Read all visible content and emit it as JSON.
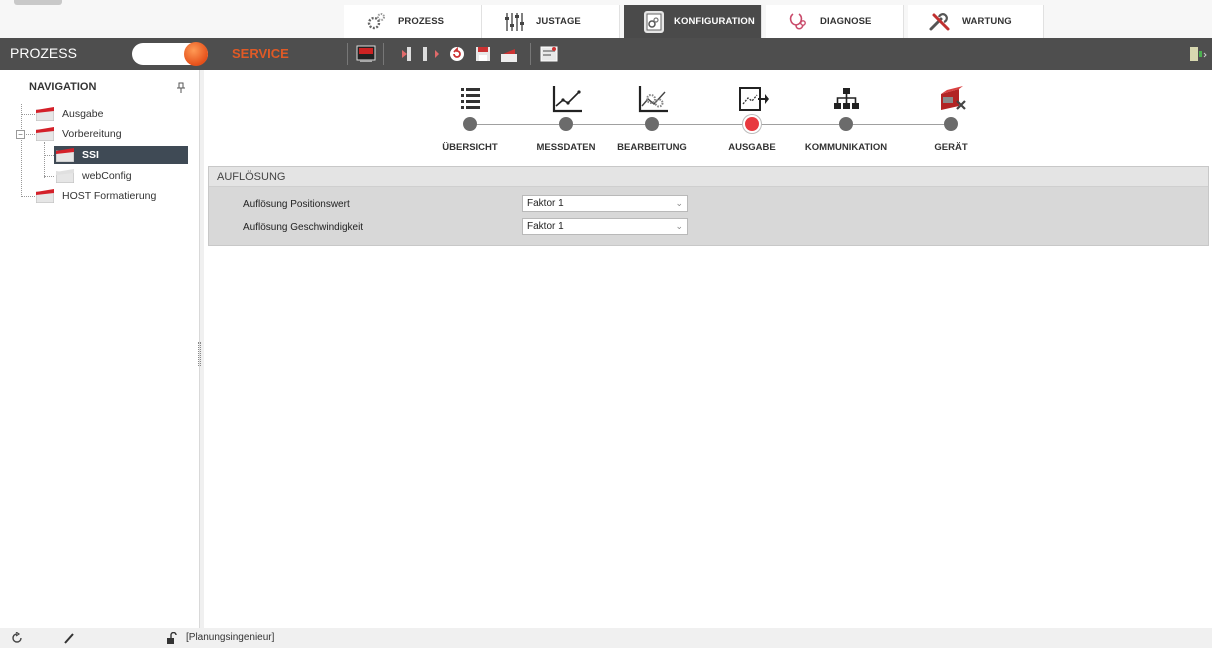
{
  "top_tabs": [
    {
      "label": "PROZESS",
      "icon": "gears-icon"
    },
    {
      "label": "JUSTAGE",
      "icon": "sliders-icon"
    },
    {
      "label": "KONFIGURATION",
      "icon": "config-icon",
      "active": true
    },
    {
      "label": "DIAGNOSE",
      "icon": "stethoscope-icon"
    },
    {
      "label": "WARTUNG",
      "icon": "tools-icon"
    }
  ],
  "toolbar": {
    "mode_label": "PROZESS",
    "service_label": "SERVICE",
    "buttons": [
      "display-icon",
      "download-device-icon",
      "upload-device-icon",
      "reset-icon",
      "save-icon",
      "erase-icon",
      "report-icon"
    ],
    "right_button": "device-status-icon"
  },
  "navigation": {
    "title": "NAVIGATION",
    "items": [
      {
        "label": "Ausgabe",
        "level": 1
      },
      {
        "label": "Vorbereitung",
        "level": 1,
        "expandable": true
      },
      {
        "label": "SSI",
        "level": 2,
        "selected": true
      },
      {
        "label": "webConfig",
        "level": 2
      },
      {
        "label": "HOST Formatierung",
        "level": 1
      }
    ]
  },
  "steps": [
    {
      "label": "ÜBERSICHT",
      "icon": "list-icon"
    },
    {
      "label": "MESSDATEN",
      "icon": "line-chart-icon"
    },
    {
      "label": "BEARBEITUNG",
      "icon": "chart-gears-icon"
    },
    {
      "label": "AUSGABE",
      "icon": "output-icon",
      "active": true
    },
    {
      "label": "KOMMUNIKATION",
      "icon": "network-icon"
    },
    {
      "label": "GERÄT",
      "icon": "device-icon"
    }
  ],
  "section": {
    "title": "AUFLÖSUNG",
    "rows": [
      {
        "label": "Auflösung Positionswert",
        "value": "Faktor 1"
      },
      {
        "label": "Auflösung Geschwindigkeit",
        "value": "Faktor 1"
      }
    ]
  },
  "status_bar": {
    "user_role": "[Planungsingenieur]"
  },
  "colors": {
    "accent_red": "#e8393f",
    "toolbar_bg": "#4e4e4e",
    "service_orange": "#e05a26",
    "selected_nav_bg": "#3f4a55"
  }
}
